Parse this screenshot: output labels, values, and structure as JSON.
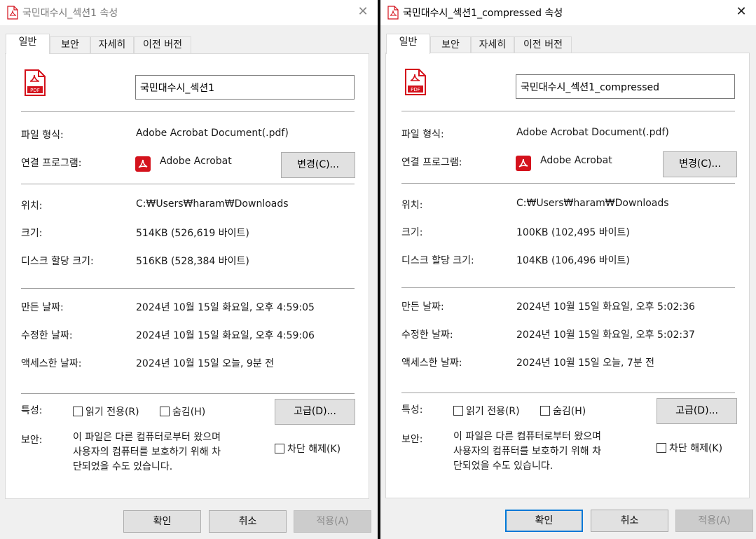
{
  "common": {
    "tabs": [
      "일반",
      "보안",
      "자세히",
      "이전 버전"
    ],
    "labels": {
      "file_type": "파일 형식:",
      "opens_with": "연결 프로그램:",
      "location": "위치:",
      "size": "크기:",
      "size_on_disk": "디스크 할당 크기:",
      "created": "만든 날짜:",
      "modified": "수정한 날짜:",
      "accessed": "액세스한 날짜:",
      "attributes": "특성:",
      "security": "보안:"
    },
    "change_button": "변경(C)...",
    "advanced_button": "고급(D)...",
    "readonly_label": "읽기 전용(R)",
    "hidden_label": "숨김(H)",
    "security_text": "이 파일은 다른 컴퓨터로부터 왔으며 사용자의 컴퓨터를 보호하기 위해 차단되었을 수도 있습니다.",
    "unblock_label": "차단 해제(K)",
    "ok_button": "확인",
    "cancel_button": "취소",
    "apply_button": "적용(A)",
    "close_symbol": "✕",
    "pdf_icon_text": "PDF",
    "accent_colors": {
      "pdf_red": "#d4121c",
      "focus_blue": "#0078d7"
    }
  },
  "left": {
    "title": "국민대수시_섹션1 속성",
    "file_name": "국민대수시_섹션1",
    "file_type": "Adobe Acrobat Document(.pdf)",
    "opens_with": "Adobe Acrobat",
    "location": "C:₩Users₩haram₩Downloads",
    "size": "514KB (526,619 바이트)",
    "size_on_disk": "516KB (528,384 바이트)",
    "created": "2024년 10월 15일 화요일, 오후 4:59:05",
    "modified": "2024년 10월 15일 화요일, 오후 4:59:06",
    "accessed": "2024년 10월 15일 오늘, 9분 전"
  },
  "right": {
    "title": "국민대수시_섹션1_compressed 속성",
    "file_name": "국민대수시_섹션1_compressed",
    "file_type": "Adobe Acrobat Document(.pdf)",
    "opens_with": "Adobe Acrobat",
    "location": "C:₩Users₩haram₩Downloads",
    "size": "100KB (102,495 바이트)",
    "size_on_disk": "104KB (106,496 바이트)",
    "created": "2024년 10월 15일 화요일, 오후 5:02:36",
    "modified": "2024년 10월 15일 화요일, 오후 5:02:37",
    "accessed": "2024년 10월 15일 오늘, 7분 전"
  }
}
